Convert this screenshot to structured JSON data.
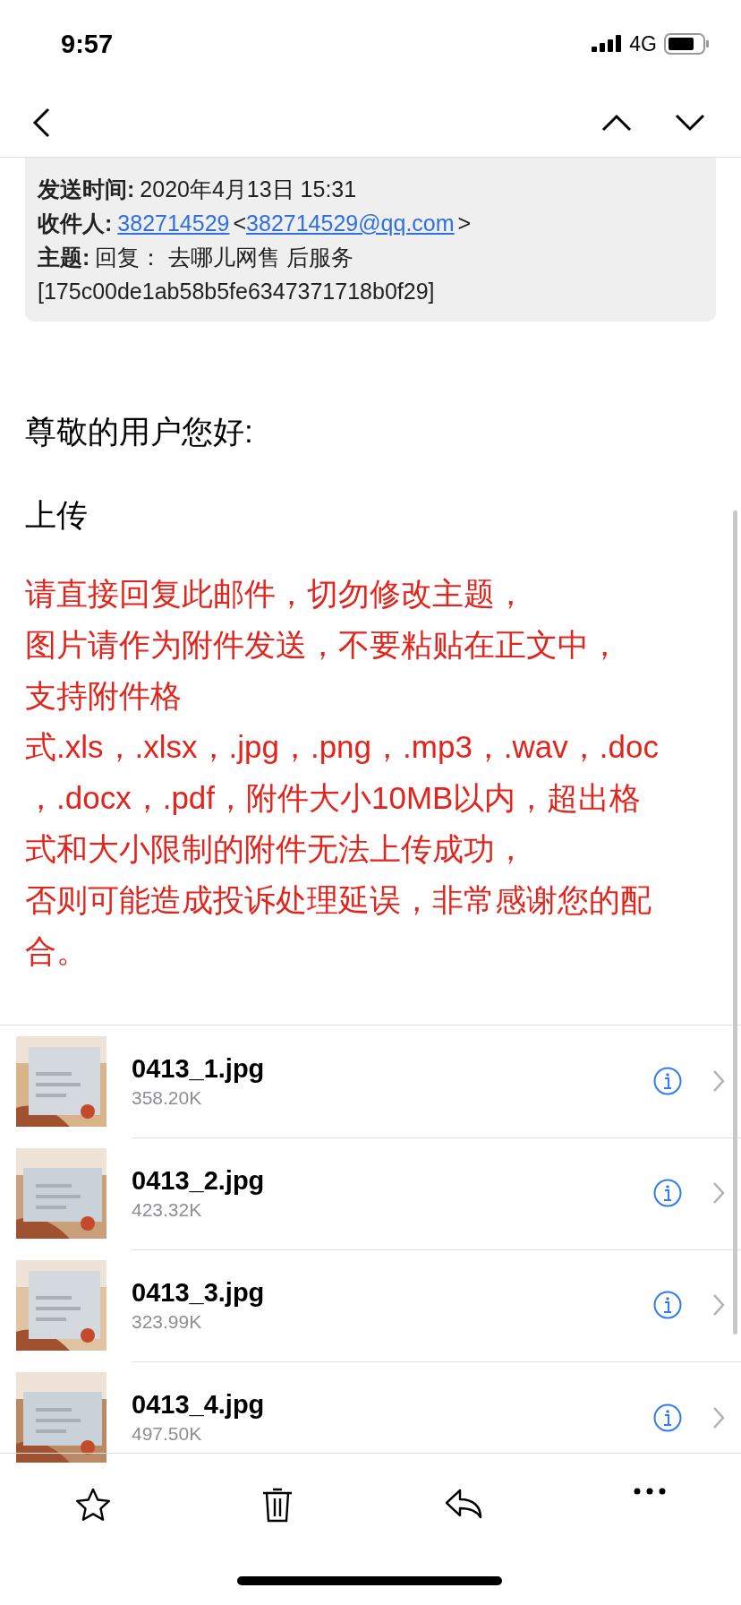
{
  "status_bar": {
    "time": "9:57",
    "network": "4G"
  },
  "header": {
    "lines": [
      {
        "segments": [
          {
            "kind": "label",
            "text": "发送时间:"
          },
          {
            "kind": "text",
            "text": "2020年4月13日 15:31"
          }
        ]
      },
      {
        "segments": [
          {
            "kind": "label",
            "text": "收件人:"
          },
          {
            "kind": "link",
            "text": "382714529"
          },
          {
            "kind": "text",
            "text": "<"
          },
          {
            "kind": "link",
            "text": "382714529@qq.com"
          },
          {
            "kind": "text",
            "text": ">"
          }
        ]
      },
      {
        "segments": [
          {
            "kind": "label",
            "text": "主题:"
          },
          {
            "kind": "text",
            "text": "回复：  去哪儿网售 后服务"
          }
        ]
      },
      {
        "segments": [
          {
            "kind": "text",
            "text": "[175c00de1ab58b5fe6347371718b0f29]"
          }
        ]
      }
    ]
  },
  "body": [
    {
      "kind": "plain",
      "text": "尊敬的用户您好:"
    },
    {
      "kind": "plain",
      "text": "上传"
    },
    {
      "kind": "notice",
      "lines": [
        "请直接回复此邮件，切勿修改主题，",
        "图片请作为附件发送，不要粘贴在正文中，",
        "支持附件格",
        "式.xls，.xlsx，.jpg，.png，.mp3，.wav，.doc",
        "，.docx，.pdf，附件大小10MB以内，超出格",
        "式和大小限制的附件无法上传成功，",
        "否则可能造成投诉处理延误，非常感谢您的配",
        "合。"
      ]
    }
  ],
  "attachments": [
    {
      "name": "0413_1.jpg",
      "size": "358.20K"
    },
    {
      "name": "0413_2.jpg",
      "size": "423.32K"
    },
    {
      "name": "0413_3.jpg",
      "size": "323.99K"
    },
    {
      "name": "0413_4.jpg",
      "size": "497.50K"
    }
  ]
}
